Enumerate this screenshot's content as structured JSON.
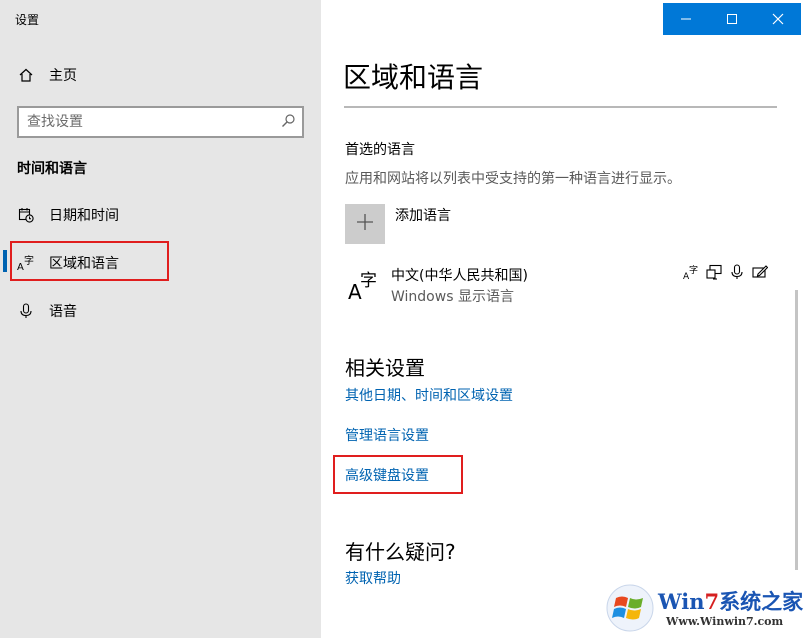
{
  "window": {
    "title": "设置"
  },
  "sidebar": {
    "home_label": "主页",
    "search_placeholder": "查找设置",
    "section_title": "时间和语言",
    "items": [
      {
        "label": "日期和时间",
        "icon": "calendar-clock-icon"
      },
      {
        "label": "区域和语言",
        "icon": "language-glyph-icon",
        "selected": true
      },
      {
        "label": "语音",
        "icon": "microphone-icon"
      }
    ]
  },
  "main": {
    "title": "区域和语言",
    "preferred": {
      "heading": "首选的语言",
      "description": "应用和网站将以列表中受支持的第一种语言进行显示。",
      "add_label": "添加语言",
      "language_name": "中文(中华人民共和国)",
      "language_sub": "Windows 显示语言",
      "glyph_text": "字",
      "glyph_latin": "A",
      "feature_icons": [
        "display-language-icon",
        "text-input-icon",
        "speech-icon",
        "handwriting-icon"
      ]
    },
    "related": {
      "heading": "相关设置",
      "links": [
        "其他日期、时间和区域设置",
        "管理语言设置",
        "高级键盘设置"
      ]
    },
    "help": {
      "heading": "有什么疑问?",
      "link": "获取帮助"
    }
  },
  "watermark": {
    "brand_a": "Win",
    "brand_seven": "7",
    "brand_b": "系统之家",
    "url": "Www.Winwin7.com"
  },
  "colors": {
    "accent": "#0078d7",
    "link": "#0063b1",
    "highlight_box": "#e01e1e",
    "sidebar_bg": "#e6e6e6"
  }
}
